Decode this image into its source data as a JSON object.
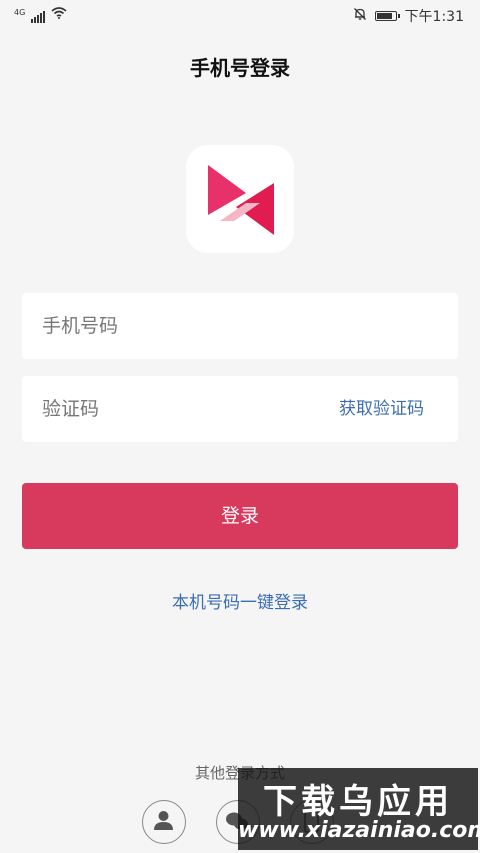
{
  "status_bar": {
    "network": "4G",
    "time": "下午1:31"
  },
  "header": {
    "title": "手机号登录"
  },
  "form": {
    "phone_placeholder": "手机号码",
    "code_placeholder": "验证码",
    "get_code_label": "获取验证码",
    "login_label": "登录",
    "quick_login_label": "本机号码一键登录"
  },
  "other_login": {
    "title": "其他登录方式"
  },
  "watermark": {
    "line1": "下载乌应用",
    "line2": "www.xiazainiao.com"
  },
  "colors": {
    "accent": "#d83a5e",
    "link": "#3b6db5",
    "logo_pink": "#e8306a",
    "logo_red": "#e01c50"
  },
  "icons": [
    "signal-icon",
    "wifi-icon",
    "bell-off-icon",
    "battery-icon",
    "person-icon",
    "wechat-icon",
    "phone-icon"
  ]
}
